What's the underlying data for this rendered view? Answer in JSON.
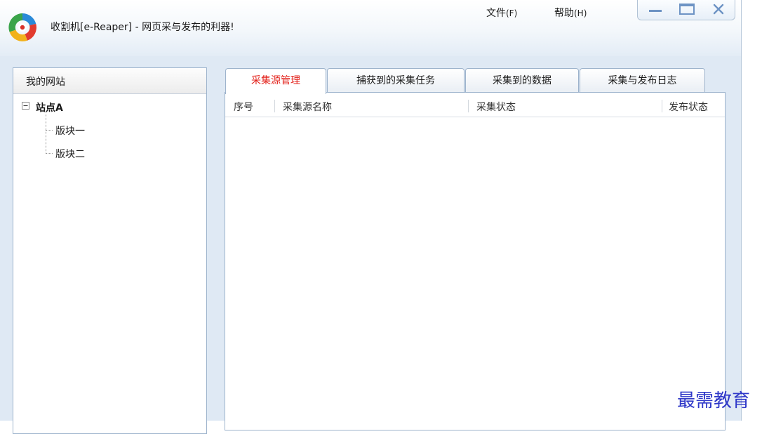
{
  "window": {
    "title": "收割机[e-Reaper] - 网页采与发布的利器!",
    "icons": {
      "logo": "app-logo-icon",
      "minimize": "minimize-icon",
      "maximize": "maximize-icon",
      "close": "close-icon"
    }
  },
  "menu": {
    "file_label": "文件",
    "file_accel": "(F)",
    "help_label": "帮助",
    "help_accel": "(H)"
  },
  "sidebar": {
    "header": "我的网站",
    "tree": {
      "toggle": "⊟",
      "site": "站点A",
      "children": [
        "版块一",
        "版块二"
      ]
    }
  },
  "tabs": [
    "采集源管理",
    "捕获到的采集任务",
    "采集到的数据",
    "采集与发布日志"
  ],
  "active_tab": 0,
  "grid": {
    "columns": [
      "序号",
      "采集源名称",
      "采集状态",
      "发布状态"
    ],
    "rows": []
  },
  "watermark": "最需教育",
  "colors": {
    "active_tab_text": "#e3221b",
    "watermark": "#2e37c8",
    "frame": "#dfe9f4"
  }
}
